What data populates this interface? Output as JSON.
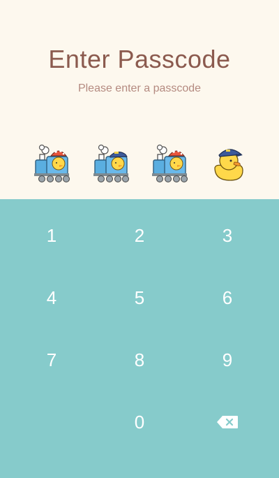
{
  "header": {
    "title": "Enter Passcode",
    "subtitle": "Please enter a passcode"
  },
  "indicators": [
    {
      "state": "filled",
      "character": "train-mushroom-duck-icon"
    },
    {
      "state": "filled",
      "character": "train-conductor-duck-icon"
    },
    {
      "state": "filled",
      "character": "train-mushroom-duck-icon"
    },
    {
      "state": "empty",
      "character": "conductor-duck-icon"
    }
  ],
  "keypad": {
    "keys": [
      "1",
      "2",
      "3",
      "4",
      "5",
      "6",
      "7",
      "8",
      "9",
      "",
      "0",
      "delete"
    ],
    "delete_icon": "backspace-icon"
  },
  "colors": {
    "top_background": "#fdf8ee",
    "keypad_background": "#86cbcb",
    "title": "#8b5a4e",
    "subtitle": "#b48a80",
    "key_text": "#ffffff"
  }
}
